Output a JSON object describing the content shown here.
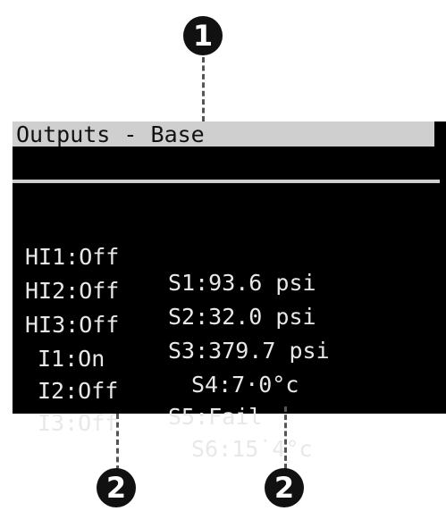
{
  "callouts": {
    "top": "1",
    "bottom_left": "2",
    "bottom_right": "2"
  },
  "screen": {
    "title": "Outputs - Base",
    "rows": [
      {
        "output": "HI1:Off",
        "sensor": "S1:93.6 psi"
      },
      {
        "output": "HI2:Off",
        "sensor": "S2:32.0 psi"
      },
      {
        "output": "HI3:Off",
        "sensor": "S3:379.7 psi"
      },
      {
        "output": "I1:On",
        "sensor": "S4:7·0°c"
      },
      {
        "output": "I2:Off",
        "sensor": "S5:Fail"
      },
      {
        "output": "I3:Off",
        "sensor": "S6:15˙4°c"
      }
    ]
  },
  "colors": {
    "screen_bg": "#000000",
    "text": "#e8e8e8",
    "titlebar_bg": "#cfcfcf",
    "callout_bg": "#111111"
  }
}
